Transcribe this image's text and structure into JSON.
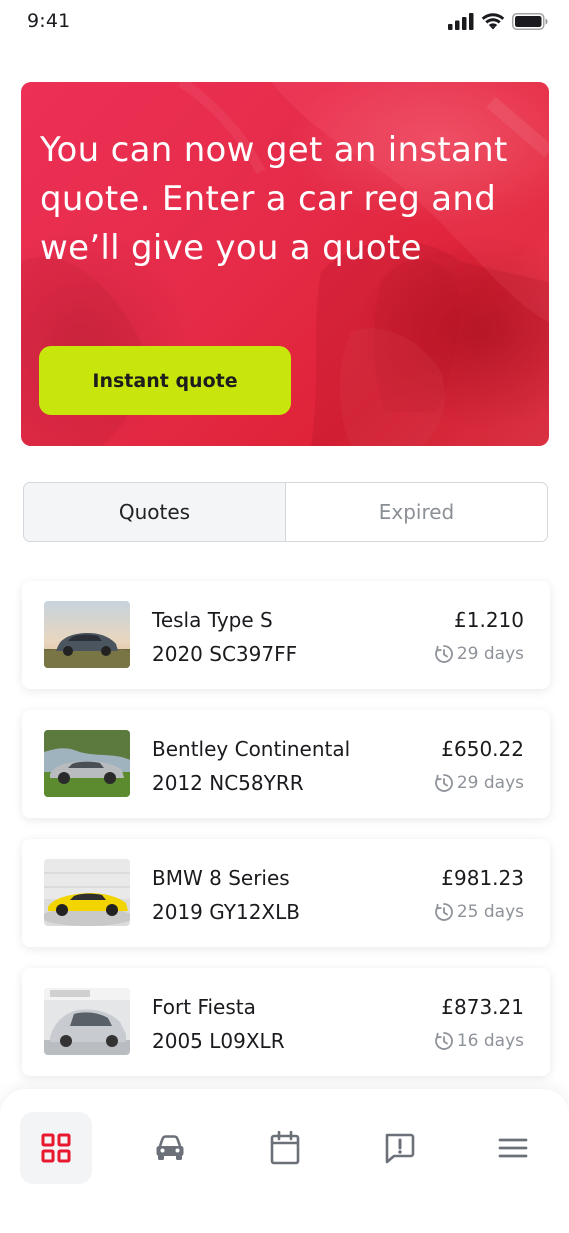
{
  "status_bar": {
    "time": "9:41"
  },
  "promo": {
    "text": "You can now get an instant quote. Enter a car reg and we’ll give you a quote",
    "button_label": "Instant quote"
  },
  "tabs": [
    {
      "label": "Quotes",
      "active": true
    },
    {
      "label": "Expired",
      "active": false
    }
  ],
  "quotes": [
    {
      "name": "Tesla Type S",
      "reg": "2020 SC397FF",
      "price": "£1.210",
      "expiry": "29 days"
    },
    {
      "name": "Bentley Continental",
      "reg": "2012 NC58YRR",
      "price": "£650.22",
      "expiry": "29 days"
    },
    {
      "name": "BMW 8 Series",
      "reg": "2019 GY12XLB",
      "price": "£981.23",
      "expiry": "25 days"
    },
    {
      "name": "Fort Fiesta",
      "reg": "2005 L09XLR",
      "price": "£873.21",
      "expiry": "16 days"
    }
  ],
  "bottom_nav": {
    "active_index": 0,
    "items": [
      "dashboard-icon",
      "car-icon",
      "calendar-icon",
      "report-message-icon",
      "menu-icon"
    ]
  },
  "colors": {
    "brand": "#E52B48",
    "accent": "#C8E60C",
    "nav_active": "#E8182E",
    "nav_inactive": "#6B7079"
  }
}
